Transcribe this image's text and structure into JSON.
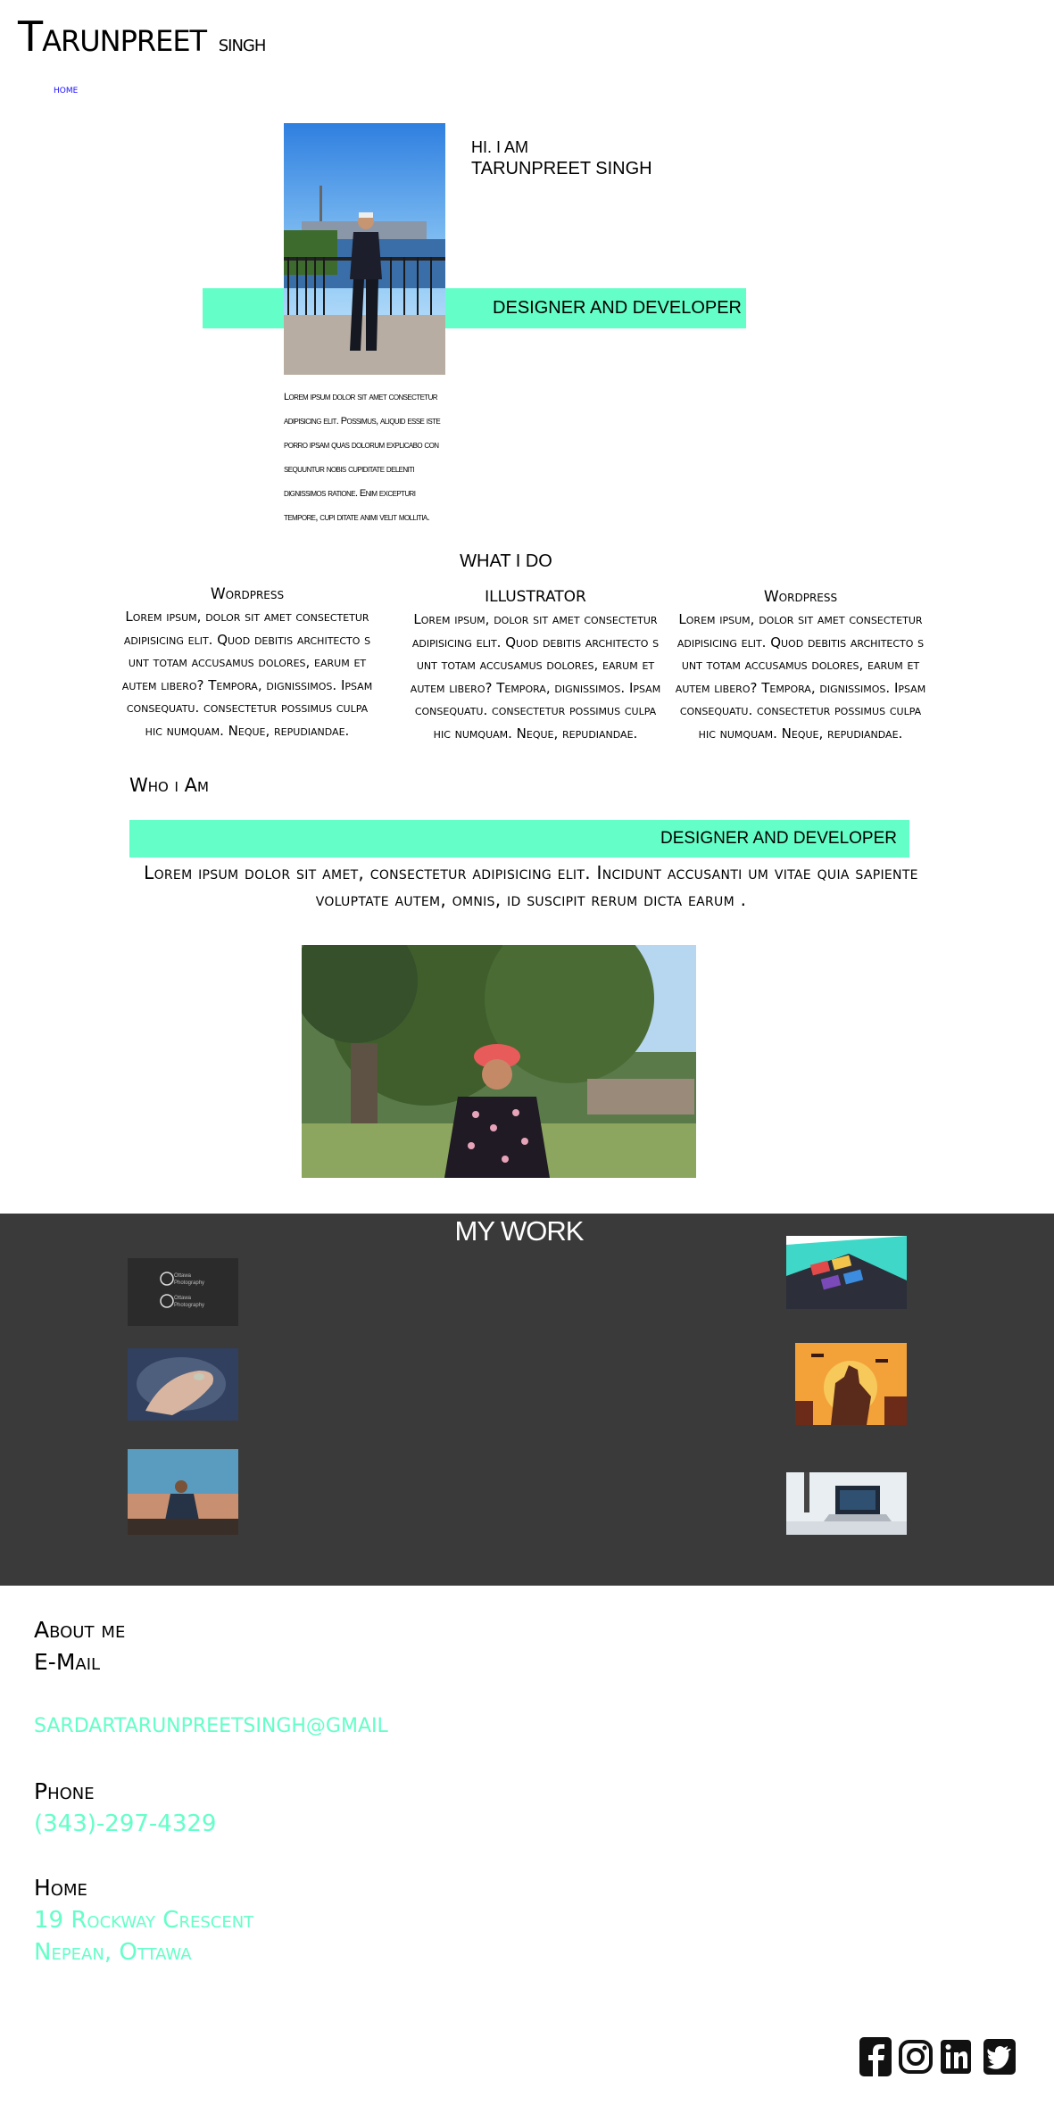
{
  "header": {
    "name_main": "Tarunpreet",
    "name_small": "singh"
  },
  "nav": {
    "home": "HOME"
  },
  "hero": {
    "greeting": "HI. I AM",
    "name": "TARUNPREET SINGH",
    "role": "DESIGNER AND DEVELOPER",
    "lorem": "Lorem ipsum dolor sit amet consectetur adipisicing elit. Possimus, aliquid esse iste porro ipsam quas dolorum explicabo con sequuntur nobis cupiditate deleniti dignissimos ratione. Enim excepturi tempore, cupi ditate animi velit mollitia."
  },
  "what_i_do": {
    "title": "WHAT I DO",
    "services": [
      {
        "title": "Wordpress",
        "text": "Lorem ipsum, dolor sit amet consectetur adipisicing elit. Quod debitis architecto s unt totam accusamus dolores, earum et autem libero? Tempora, dignissimos. Ipsam consequatu. consectetur possimus culpa hic numquam. Neque, repudiandae."
      },
      {
        "title": "ILLUSTRATOR",
        "text": "Lorem ipsum, dolor sit amet consectetur adipisicing elit. Quod debitis architecto s unt totam accusamus dolores, earum et autem libero? Tempora, dignissimos. Ipsam consequatu. consectetur possimus culpa hic numquam. Neque, repudiandae."
      },
      {
        "title": "Wordpress",
        "text": "Lorem ipsum, dolor sit amet consectetur adipisicing elit. Quod debitis architecto s unt totam accusamus dolores, earum et autem libero? Tempora, dignissimos. Ipsam consequatu. consectetur possimus culpa hic numquam. Neque, repudiandae."
      }
    ]
  },
  "who_i_am": {
    "title": "Who i Am",
    "role": "DESIGNER AND DEVELOPER",
    "text": "Lorem ipsum dolor sit amet, consectetur adipisicing elit. Incidunt accusanti um vitae quia sapiente voluptate autem, omnis, id suscipit rerum dicta earum ."
  },
  "my_work": {
    "title": "MY WORK",
    "thumb_0_text": [
      "Ottawa",
      "Photography",
      "Ottawa",
      "Photography"
    ]
  },
  "contact": {
    "about_label": "About me",
    "email_label": "E-Mail",
    "email_value": "SARDARTARUNPREETSINGH@GMAIL",
    "phone_label": "Phone",
    "phone_value": "(343)-297-4329",
    "home_label": "Home",
    "address_line_1": "19 Rockway Crescent",
    "address_line_2": "Nepean, Ottawa"
  },
  "socials": [
    "facebook-icon",
    "instagram-icon",
    "linkedin-icon",
    "twitter-icon"
  ],
  "colors": {
    "accent": "#64ffc8",
    "work_bg": "#3a3a3a",
    "link": "#1a0dff"
  }
}
